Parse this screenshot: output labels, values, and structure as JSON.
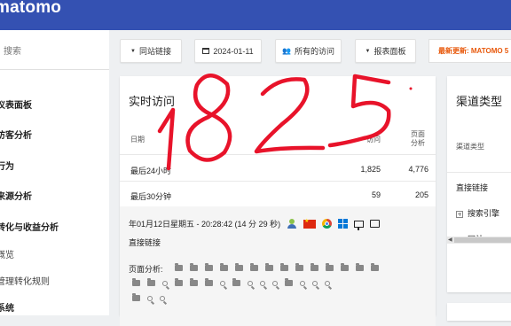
{
  "logo": "matomo",
  "search": {
    "placeholder": "搜索"
  },
  "sidebar": {
    "items": [
      {
        "label": "仪表面板",
        "type": "section"
      },
      {
        "label": "访客分析",
        "type": "section"
      },
      {
        "label": "行为",
        "type": "section"
      },
      {
        "label": "来源分析",
        "type": "section"
      },
      {
        "label": "转化与收益分析",
        "type": "section"
      },
      {
        "label": "概览",
        "type": "sub"
      },
      {
        "label": "管理转化规则",
        "type": "sub"
      },
      {
        "label": "系统",
        "type": "section"
      }
    ]
  },
  "toolbar": {
    "segment_label": "同站链接",
    "date_label": "2024-01-11",
    "visits_label": "所有的访问",
    "dashboard_label": "报表面板",
    "news_label": "最新更新: MATOMO 5"
  },
  "realtime": {
    "title": "实时访问",
    "columns": {
      "date": "日期",
      "visits": "访问",
      "pageviews": "页面\n分析"
    },
    "rows": [
      {
        "label": "最后24小时",
        "visits": "1,825",
        "pageviews": "4,776"
      },
      {
        "label": "最后30分钟",
        "visits": "59",
        "pageviews": "205"
      }
    ],
    "visit": {
      "datetime": "年01月12日星期五 - 20:28:42 (14 分 29 秒)",
      "referrer": "直接链接",
      "actions_label": "页面分析:"
    }
  },
  "channel": {
    "title": "渠道类型",
    "column": "渠道类型",
    "rows": [
      {
        "label": "直接链接",
        "expandable": false
      },
      {
        "label": "搜索引擎",
        "expandable": true
      },
      {
        "label": "网站",
        "expandable": true
      }
    ]
  },
  "annotation": {
    "text": "1825",
    "color": "#e8132a"
  },
  "colors": {
    "brand": "#3451b2",
    "accent": "#e8590c"
  }
}
